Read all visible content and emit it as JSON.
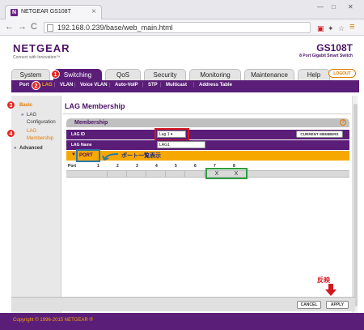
{
  "browser": {
    "tab_title": "NETGEAR GS108T",
    "tab_favicon": "N",
    "url": "192.168.0.239/base/web_main.html",
    "back": "←",
    "forward": "→",
    "reload": "C",
    "minimize": "—",
    "maximize": "□",
    "close": "✕",
    "menu": "≡",
    "star": "☆"
  },
  "header": {
    "logo": "NETGEAR",
    "logo_sub": "Connect with Innovation™",
    "model": "GS108T",
    "model_sub": "8 Port Gigabit Smart Switch",
    "logout": "LOGOUT"
  },
  "main_tabs": [
    "System",
    "Switching",
    "QoS",
    "Security",
    "Monitoring",
    "Maintenance",
    "Help"
  ],
  "sub_nav": [
    "Port",
    "LAG",
    "VLAN",
    "Voice VLAN",
    "Auto-VoIP",
    "STP",
    "Multicast",
    "Address Table"
  ],
  "steps": [
    "1",
    "2",
    "3",
    "4"
  ],
  "left_nav": {
    "basic": "Basic",
    "lag_config_1": "LAG",
    "lag_config_2": "Configuration",
    "lag_membership_1": "LAG",
    "lag_membership_2": "Membership",
    "advanced": "Advanced",
    "arrow": "»"
  },
  "content": {
    "title": "LAG Membership",
    "panel_title": "Membership",
    "help": "?",
    "lag_id_label": "LAG ID",
    "lag_id_value": "Lag 1",
    "current_members": "CURRENT MEMBERS",
    "lag_name_label": "LAG Name",
    "lag_name_value": "LAG1",
    "port_toggle": "▼",
    "port_label": "PORT",
    "annotation": "ポート一覧表示",
    "port_header": "Port",
    "ports": [
      "1",
      "2",
      "3",
      "4",
      "5",
      "6",
      "7",
      "8"
    ],
    "selected_marks": [
      "X",
      "X"
    ]
  },
  "buttons": {
    "cancel": "CANCEL",
    "apply": "APPLY",
    "apply_annotation": "反映"
  },
  "footer": {
    "copyright": "Copyright © 1996-2015 NETGEAR ®"
  },
  "colors": {
    "brand_purple": "#5a1d78",
    "accent_orange": "#f7a800",
    "annotation_red": "#d4171f",
    "annotation_blue": "#2a7ab0",
    "annotation_green": "#2e9c3e"
  }
}
